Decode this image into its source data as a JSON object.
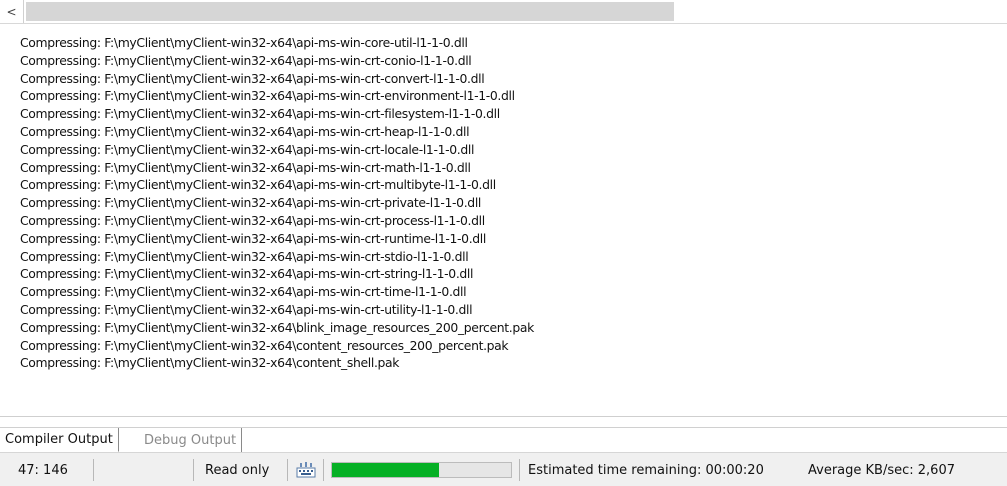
{
  "scrollbar": {
    "left_arrow_glyph": "<"
  },
  "log": {
    "lines": [
      "Compressing: F:\\myClient\\myClient-win32-x64\\api-ms-win-core-util-l1-1-0.dll",
      "Compressing: F:\\myClient\\myClient-win32-x64\\api-ms-win-crt-conio-l1-1-0.dll",
      "Compressing: F:\\myClient\\myClient-win32-x64\\api-ms-win-crt-convert-l1-1-0.dll",
      "Compressing: F:\\myClient\\myClient-win32-x64\\api-ms-win-crt-environment-l1-1-0.dll",
      "Compressing: F:\\myClient\\myClient-win32-x64\\api-ms-win-crt-filesystem-l1-1-0.dll",
      "Compressing: F:\\myClient\\myClient-win32-x64\\api-ms-win-crt-heap-l1-1-0.dll",
      "Compressing: F:\\myClient\\myClient-win32-x64\\api-ms-win-crt-locale-l1-1-0.dll",
      "Compressing: F:\\myClient\\myClient-win32-x64\\api-ms-win-crt-math-l1-1-0.dll",
      "Compressing: F:\\myClient\\myClient-win32-x64\\api-ms-win-crt-multibyte-l1-1-0.dll",
      "Compressing: F:\\myClient\\myClient-win32-x64\\api-ms-win-crt-private-l1-1-0.dll",
      "Compressing: F:\\myClient\\myClient-win32-x64\\api-ms-win-crt-process-l1-1-0.dll",
      "Compressing: F:\\myClient\\myClient-win32-x64\\api-ms-win-crt-runtime-l1-1-0.dll",
      "Compressing: F:\\myClient\\myClient-win32-x64\\api-ms-win-crt-stdio-l1-1-0.dll",
      "Compressing: F:\\myClient\\myClient-win32-x64\\api-ms-win-crt-string-l1-1-0.dll",
      "Compressing: F:\\myClient\\myClient-win32-x64\\api-ms-win-crt-time-l1-1-0.dll",
      "Compressing: F:\\myClient\\myClient-win32-x64\\api-ms-win-crt-utility-l1-1-0.dll",
      "Compressing: F:\\myClient\\myClient-win32-x64\\blink_image_resources_200_percent.pak",
      "Compressing: F:\\myClient\\myClient-win32-x64\\content_resources_200_percent.pak",
      "Compressing: F:\\myClient\\myClient-win32-x64\\content_shell.pak"
    ]
  },
  "tabs": {
    "compiler_output": "Compiler Output",
    "debug_output": "Debug Output"
  },
  "status": {
    "cursor_position": "47: 146",
    "read_only": "Read only",
    "progress_fraction": 0.6,
    "progress_color": "#06b025",
    "time_remaining": "Estimated time remaining: 00:00:20",
    "average_speed": "Average KB/sec: 2,607",
    "keyboard_icon": "keyboard-icon"
  }
}
